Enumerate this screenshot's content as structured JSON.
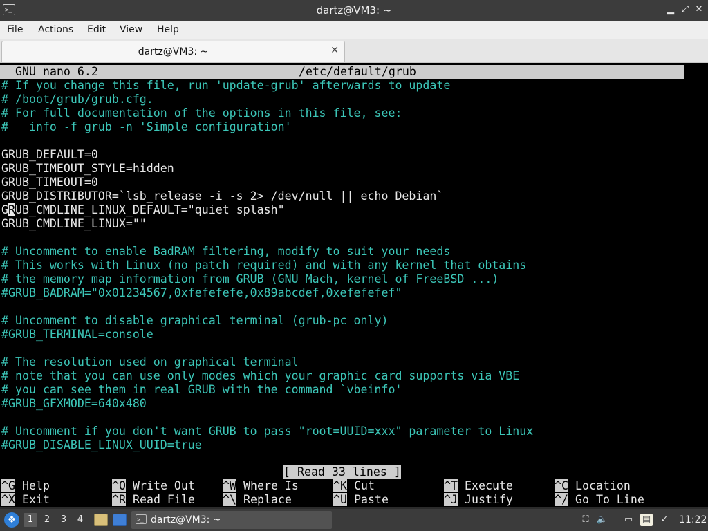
{
  "window": {
    "title": "dartz@VM3: ~",
    "terminal_icon_glyph": ">_",
    "controls": {
      "minimize": "▁",
      "maximize": "⤢",
      "close": "✕"
    }
  },
  "menu": [
    "File",
    "Actions",
    "Edit",
    "View",
    "Help"
  ],
  "tab": {
    "label": "dartz@VM3: ~",
    "close_glyph": "✕"
  },
  "nano": {
    "version": "GNU nano 6.2",
    "filename": "/etc/default/grub",
    "cursor_char": "R",
    "lines": [
      {
        "text": "# If you change this file, run 'update-grub' afterwards to update",
        "style": "comment"
      },
      {
        "text": "# /boot/grub/grub.cfg.",
        "style": "comment"
      },
      {
        "text": "# For full documentation of the options in this file, see:",
        "style": "comment"
      },
      {
        "text": "#   info -f grub -n 'Simple configuration'",
        "style": "comment"
      },
      {
        "text": "",
        "style": "code"
      },
      {
        "text": "GRUB_DEFAULT=0",
        "style": "code"
      },
      {
        "text": "GRUB_TIMEOUT_STYLE=hidden",
        "style": "code"
      },
      {
        "text": "GRUB_TIMEOUT=0",
        "style": "code"
      },
      {
        "text": "GRUB_DISTRIBUTOR=`lsb_release -i -s 2> /dev/null || echo Debian`",
        "style": "code"
      },
      {
        "text": "GRUB_CMDLINE_LINUX_DEFAULT=\"quiet splash\"",
        "style": "code"
      },
      {
        "text": "GRUB_CMDLINE_LINUX=\"\"",
        "style": "code"
      },
      {
        "text": "",
        "style": "code"
      },
      {
        "text": "# Uncomment to enable BadRAM filtering, modify to suit your needs",
        "style": "comment"
      },
      {
        "text": "# This works with Linux (no patch required) and with any kernel that obtains",
        "style": "comment"
      },
      {
        "text": "# the memory map information from GRUB (GNU Mach, kernel of FreeBSD ...)",
        "style": "comment"
      },
      {
        "text": "#GRUB_BADRAM=\"0x01234567,0xfefefefe,0x89abcdef,0xefefefef\"",
        "style": "comment"
      },
      {
        "text": "",
        "style": "code"
      },
      {
        "text": "# Uncomment to disable graphical terminal (grub-pc only)",
        "style": "comment"
      },
      {
        "text": "#GRUB_TERMINAL=console",
        "style": "comment"
      },
      {
        "text": "",
        "style": "code"
      },
      {
        "text": "# The resolution used on graphical terminal",
        "style": "comment"
      },
      {
        "text": "# note that you can use only modes which your graphic card supports via VBE",
        "style": "comment"
      },
      {
        "text": "# you can see them in real GRUB with the command `vbeinfo'",
        "style": "comment"
      },
      {
        "text": "#GRUB_GFXMODE=640x480",
        "style": "comment"
      },
      {
        "text": "",
        "style": "code"
      },
      {
        "text": "# Uncomment if you don't want GRUB to pass \"root=UUID=xxx\" parameter to Linux",
        "style": "comment"
      },
      {
        "text": "#GRUB_DISABLE_LINUX_UUID=true",
        "style": "comment"
      }
    ],
    "status": "[ Read 33 lines ]",
    "shortcuts": [
      {
        "key": "^G",
        "label": "Help"
      },
      {
        "key": "^X",
        "label": "Exit"
      },
      {
        "key": "^O",
        "label": "Write Out"
      },
      {
        "key": "^R",
        "label": "Read File"
      },
      {
        "key": "^W",
        "label": "Where Is"
      },
      {
        "key": "^\\",
        "label": "Replace"
      },
      {
        "key": "^K",
        "label": "Cut"
      },
      {
        "key": "^U",
        "label": "Paste"
      },
      {
        "key": "^T",
        "label": "Execute"
      },
      {
        "key": "^J",
        "label": "Justify"
      },
      {
        "key": "^C",
        "label": "Location"
      },
      {
        "key": "^/",
        "label": "Go To Line"
      }
    ]
  },
  "taskbar": {
    "workspaces": [
      "1",
      "2",
      "3",
      "4"
    ],
    "active_workspace": "1",
    "task_label": "dartz@VM3: ~",
    "start_icon": "lubuntu-logo-icon",
    "tray_icons": [
      "network-icon",
      "volume-icon",
      "monitor-icon",
      "clipboard-icon",
      "updates-icon"
    ],
    "clock": "11:22"
  },
  "colors": {
    "comment": "#3cc6b8",
    "code": "#e6e6e6",
    "header_bg": "#cdcdcd",
    "terminal_bg": "#000000"
  }
}
